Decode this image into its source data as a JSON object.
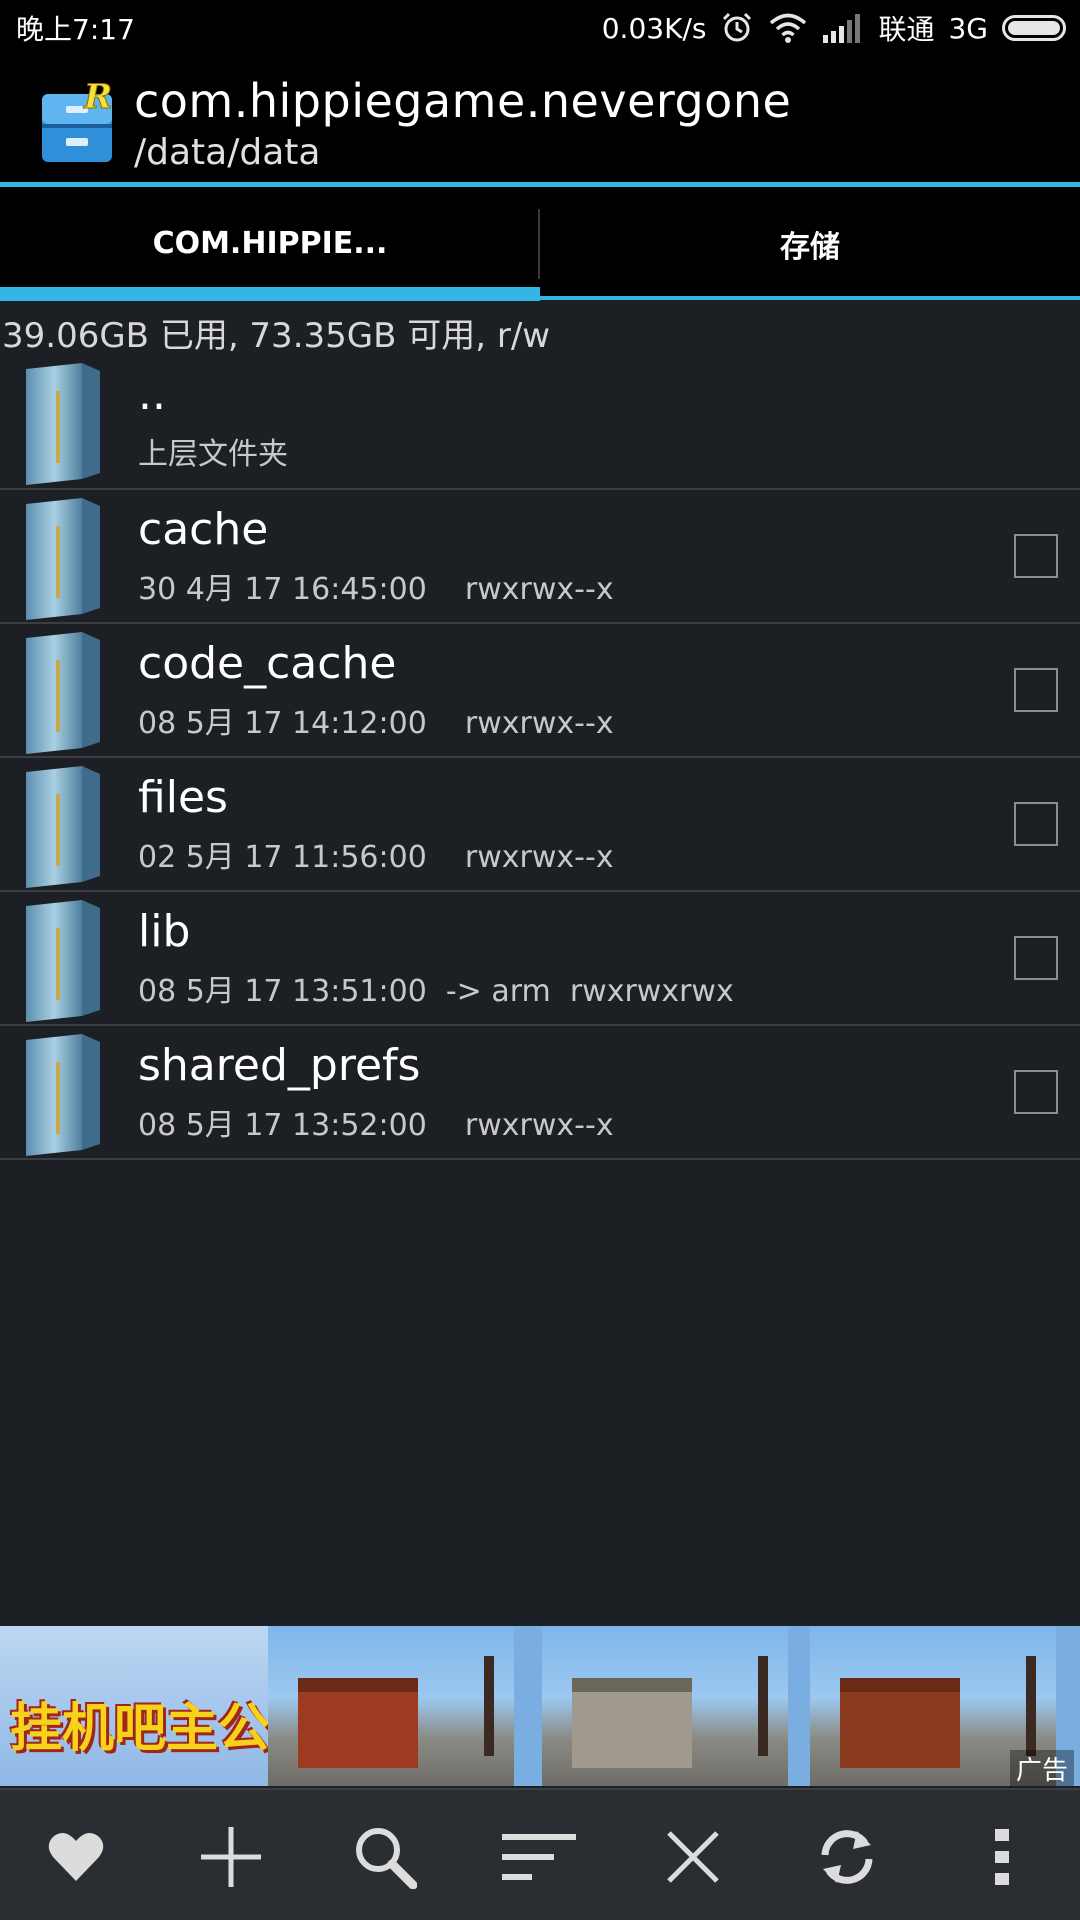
{
  "status_bar": {
    "time": "晚上7:17",
    "net_speed": "0.03K/s",
    "carrier": "联通",
    "network": "3G",
    "icons": [
      "alarm-icon",
      "wifi-icon",
      "signal-icon",
      "battery-icon"
    ]
  },
  "app_bar": {
    "title": "com.hippiegame.nevergone",
    "path": "/data/data",
    "logo_letter": "R"
  },
  "tabs": [
    {
      "label": "COM.HIPPIE...",
      "active": true
    },
    {
      "label": "存储",
      "active": false
    }
  ],
  "storage_info": "39.06GB 已用, 73.35GB 可用, r/w",
  "files": [
    {
      "name": "..",
      "meta": "上层文件夹",
      "checkbox": false
    },
    {
      "name": "cache",
      "meta": "30 4月 17 16:45:00    rwxrwx--x",
      "checkbox": true
    },
    {
      "name": "code_cache",
      "meta": "08 5月 17 14:12:00    rwxrwx--x",
      "checkbox": true
    },
    {
      "name": "files",
      "meta": "02 5月 17 11:56:00    rwxrwx--x",
      "checkbox": true
    },
    {
      "name": "lib",
      "meta": "08 5月 17 13:51:00  -> arm  rwxrwxrwx",
      "checkbox": true
    },
    {
      "name": "shared_prefs",
      "meta": "08 5月 17 13:52:00    rwxrwx--x",
      "checkbox": true
    }
  ],
  "ad": {
    "logo_text": "挂机吧主公",
    "label": "广告"
  },
  "toolbar": {
    "items": [
      "favorite-icon",
      "add-icon",
      "search-icon",
      "sort-icon",
      "close-icon",
      "refresh-icon",
      "more-vert-icon"
    ]
  },
  "colors": {
    "accent": "#33b5e5",
    "background": "#1c1f23",
    "bar": "#000000",
    "toolbar": "#2a2e33"
  }
}
